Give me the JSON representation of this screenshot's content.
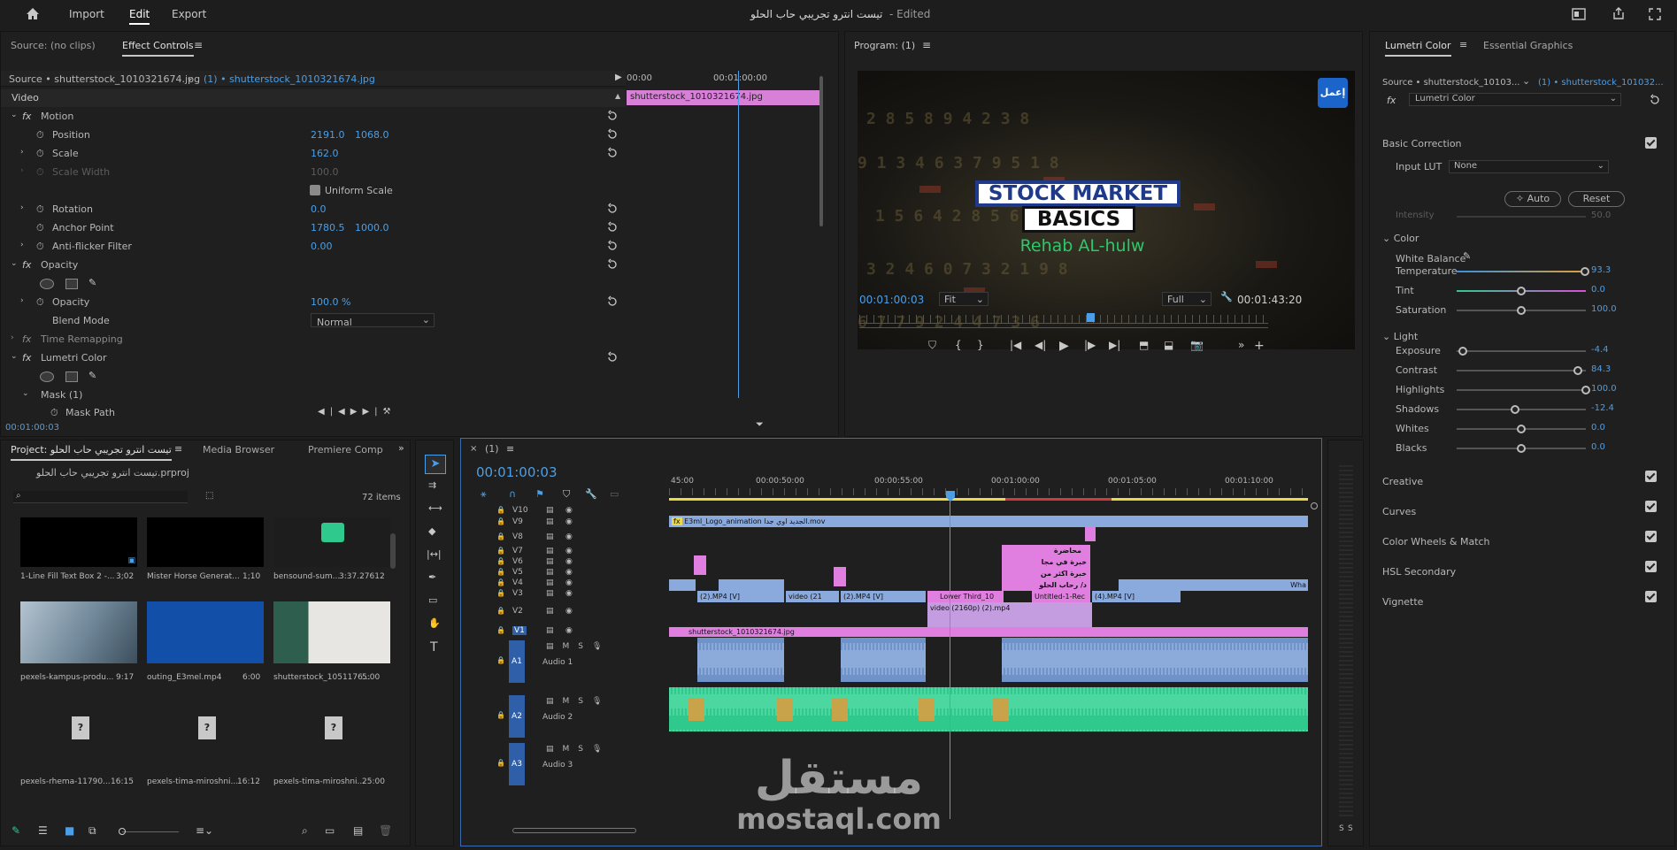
{
  "menu": {
    "import": "Import",
    "edit": "Edit",
    "export": "Export",
    "title": "تيست انترو تجريبي حاب الحلو",
    "edited": "- Edited"
  },
  "source_panel": {
    "source_tab": "Source: (no clips)",
    "effect_controls_tab": "Effect Controls",
    "source_label": "Source • shutterstock_1010321674.jpg",
    "clip_label": "(1) • shutterstock_1010321674.jpg",
    "time_start": "00:00",
    "time_mid": "00:01:00:00",
    "clip_name": "shutterstock_1010321674.jpg",
    "current_time": "00:01:00:03"
  },
  "effects": {
    "video": "Video",
    "motion": "Motion",
    "position": "Position",
    "position_x": "2191.0",
    "position_y": "1068.0",
    "scale": "Scale",
    "scale_val": "162.0",
    "scale_width": "Scale Width",
    "scale_width_val": "100.0",
    "uniform_scale": "Uniform Scale",
    "rotation": "Rotation",
    "rotation_val": "0.0",
    "anchor": "Anchor Point",
    "anchor_x": "1780.5",
    "anchor_y": "1000.0",
    "antiflicker": "Anti-flicker Filter",
    "antiflicker_val": "0.00",
    "opacity_group": "Opacity",
    "opacity": "Opacity",
    "opacity_val": "100.0 %",
    "blend_mode": "Blend Mode",
    "blend_val": "Normal",
    "time_remap": "Time Remapping",
    "lumetri": "Lumetri Color",
    "mask": "Mask (1)",
    "mask_path": "Mask Path"
  },
  "program": {
    "title": "Program: (1)",
    "timecode": "00:01:00:03",
    "fit": "Fit",
    "full": "Full",
    "duration": "00:01:43:20",
    "video_title1": "STOCK MARKET",
    "video_title2": "BASICS",
    "video_sub": "Rehab AL-hulw",
    "logo_text": "إعمل"
  },
  "project": {
    "tab": "Project: تيست انترو تجريبي حاب الحلو",
    "media_browser": "Media Browser",
    "premiere_comp": "Premiere Comp",
    "file": "تيست انترو تجريبي حاب الحلو.prproj",
    "items": "72 items",
    "thumbs": [
      {
        "name": "1-Line Fill Text Box 2 -...",
        "dur": "3;02"
      },
      {
        "name": "Mister Horse Generat...",
        "dur": "1;10"
      },
      {
        "name": "bensound-sum...",
        "dur": "3:37.27612"
      },
      {
        "name": "pexels-kampus-produ...",
        "dur": "9:17"
      },
      {
        "name": "outing_E3mel.mp4",
        "dur": "6:00"
      },
      {
        "name": "shutterstock_1051176...",
        "dur": "5:00"
      },
      {
        "name": "pexels-rhema-11790...",
        "dur": "16:15"
      },
      {
        "name": "pexels-tima-miroshni...",
        "dur": "16:12"
      },
      {
        "name": "pexels-tima-miroshni...",
        "dur": "25:00"
      }
    ]
  },
  "timeline": {
    "tab": "(1)",
    "timecode": "00:01:00:03",
    "ruler": [
      "45:00",
      "00:00:50:00",
      "00:00:55:00",
      "00:01:00:00",
      "00:01:05:00",
      "00:01:10:00"
    ],
    "video_tracks": [
      "V10",
      "V9",
      "V8",
      "V7",
      "V6",
      "V5",
      "V4",
      "V3",
      "V2",
      "V1"
    ],
    "audio_tracks": [
      {
        "id": "A1",
        "name": "Audio 1"
      },
      {
        "id": "A2",
        "name": "Audio 2"
      },
      {
        "id": "A3",
        "name": "Audio 3"
      }
    ],
    "clips": {
      "logo": "E3ml_Logo_animation الجديد اوي جدا.mov",
      "mp4_2": "(2).MP4 [V]",
      "video21": "video (21",
      "mp4_2b": "(2).MP4 [V]",
      "lower_third": "Lower Third_10",
      "video2160": "video (2160p) (2).mp4",
      "untitled": "Untitled-1-Rec",
      "mp4_4": "(4).MP4 [V]",
      "wha": "Wha",
      "v1clip": "shutterstock_1010321674.jpg",
      "arabic1": "محاضرة",
      "arabic2": "خبرة في مجا",
      "arabic3": "خبرة اكثر من",
      "arabic4": "د/ رحاب الحلو"
    }
  },
  "lumetri": {
    "tab": "Lumetri Color",
    "essential": "Essential Graphics",
    "source": "Source • shutterstock_10103...",
    "clip": "(1) • shutterstock_101032...",
    "effect": "Lumetri Color",
    "basic": "Basic Correction",
    "input_lut": "Input LUT",
    "lut_val": "None",
    "auto": "Auto",
    "reset": "Reset",
    "intensity": "Intensity",
    "intensity_val": "50.0",
    "color": "Color",
    "white_balance": "White Balance",
    "temperature": "Temperature",
    "temperature_val": "93.3",
    "tint": "Tint",
    "tint_val": "0.0",
    "saturation": "Saturation",
    "saturation_val": "100.0",
    "light": "Light",
    "exposure": "Exposure",
    "exposure_val": "-4.4",
    "contrast": "Contrast",
    "contrast_val": "84.3",
    "highlights": "Highlights",
    "highlights_val": "100.0",
    "shadows": "Shadows",
    "shadows_val": "-12.4",
    "whites": "Whites",
    "whites_val": "0.0",
    "blacks": "Blacks",
    "blacks_val": "0.0",
    "creative": "Creative",
    "curves": "Curves",
    "wheels": "Color Wheels & Match",
    "hsl": "HSL Secondary",
    "vignette": "Vignette"
  },
  "watermark": {
    "arabic": "مستقل",
    "latin": "mostaql.com"
  },
  "colors": {
    "accent": "#4a9fe8",
    "clip_video": "#8aa9dc",
    "clip_graphic": "#e07fe0",
    "audio_a1": "#6f93c9",
    "audio_a2": "#2fc98d"
  }
}
